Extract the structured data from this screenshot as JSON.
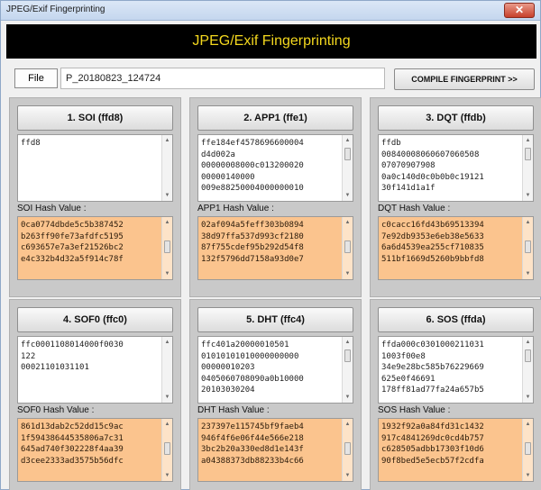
{
  "window": {
    "title": "JPEG/Exif Fingerprinting",
    "close_glyph": "✕"
  },
  "banner": {
    "text": "JPEG/Exif Fingerprinting"
  },
  "file": {
    "button_label": "File",
    "value": "P_20180823_124724"
  },
  "compile_button": "COMPILE FINGERPRINT >>",
  "panels": [
    {
      "label": "1. SOI (ffd8)",
      "segment_lines": [
        "ffd8"
      ],
      "hash_label": "SOI Hash Value :",
      "hash_lines": [
        "0ca0774dbde5c5b387452",
        "b263ff90fe73afdfc5195",
        "c693657e7a3ef21526bc2",
        "e4c332b4d32a5f914c78f"
      ]
    },
    {
      "label": "2. APP1 (ffe1)",
      "segment_lines": [
        "ffe184ef4578696600004",
        "d4d002a",
        "00000008000c013200020",
        "00000140000",
        "009e88250004000000010"
      ],
      "hash_label": "APP1 Hash Value :",
      "hash_lines": [
        "02af094a5feff303b0894",
        "38d97ffa537d993cf2180",
        "87f755cdef95b292d54f8",
        "132f5796dd7158a93d0e7"
      ]
    },
    {
      "label": "3. DQT (ffdb)",
      "segment_lines": [
        "ffdb",
        "00840008060607060508",
        "07070907908",
        "0a0c140d0c0b0b0c19121",
        "30f141d1a1f"
      ],
      "hash_label": "DQT Hash Value :",
      "hash_lines": [
        "c0cacc16fd43b69513394",
        "7e92db9353e6eb38e5633",
        "6a6d4539ea255cf710835",
        "511bf1669d5260b9bbfd8"
      ]
    },
    {
      "label": "4. SOF0 (ffc0)",
      "segment_lines": [
        "ffc0001108014000f0030",
        "122",
        "00021101031101"
      ],
      "hash_label": "SOF0 Hash Value :",
      "hash_lines": [
        "861d13dab2c52dd15c9ac",
        "1f59438644535806a7c31",
        "645ad740f302228f4aa39",
        "d3cee2333ad3575b56dfc"
      ]
    },
    {
      "label": "5. DHT (ffc4)",
      "segment_lines": [
        "ffc401a20000010501",
        "01010101010000000000",
        "00000010203",
        "0405060708090a0b10000",
        "20103030204"
      ],
      "hash_label": "DHT Hash Value :",
      "hash_lines": [
        "237397e115745bf9faeb4",
        "946f4f6e06f44e566e218",
        "3bc2b20a330ed8d1e143f",
        "a04388373db88233b4c66"
      ]
    },
    {
      "label": "6. SOS (ffda)",
      "segment_lines": [
        "ffda000c0301000211031",
        "1003f00e8",
        "34e9e28bc585b76229669",
        "625e0f46691",
        "178ff81ad77fa24a657b5"
      ],
      "hash_label": "SOS Hash Value :",
      "hash_lines": [
        "1932f92a0a84fd31c1432",
        "917c4841269dc0cd4b757",
        "c628505adbb17303f10d6",
        "90f8bed5e5ecb57f2cdfa"
      ]
    }
  ]
}
